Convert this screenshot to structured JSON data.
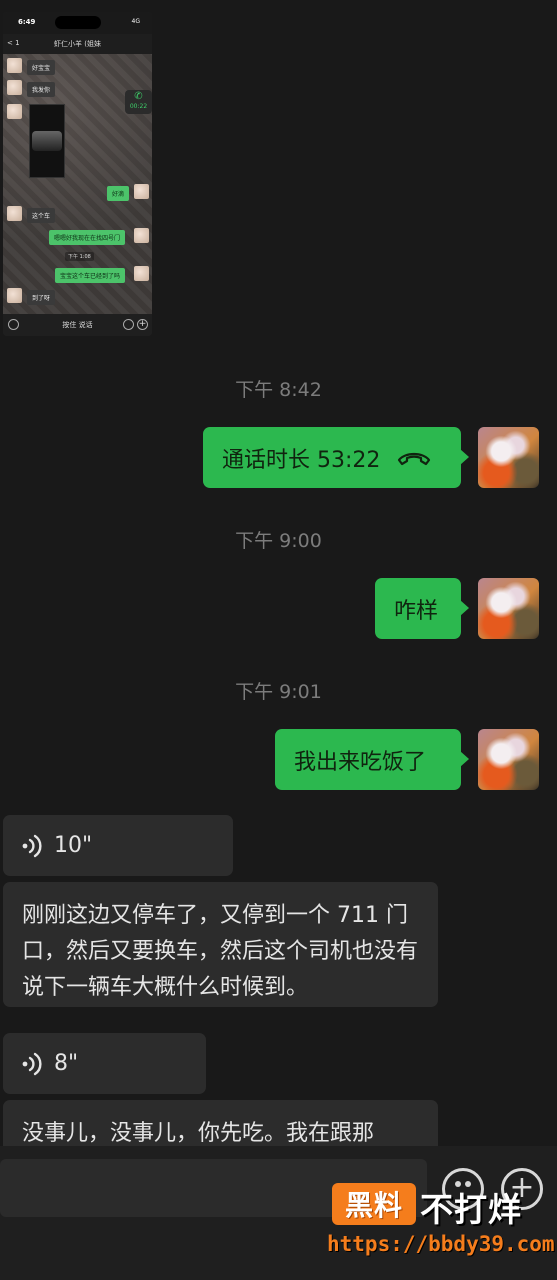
{
  "thumbnail": {
    "status_time": "6:49",
    "status_signal": "4G",
    "nav_back": "< 1",
    "nav_title": "虾仁小羊 (姐妹",
    "messages": [
      {
        "dir": "in",
        "text": "好宝宝"
      },
      {
        "dir": "in",
        "text": "我发你"
      },
      {
        "dir": "out",
        "text": "好滴"
      },
      {
        "dir": "in",
        "text": "这个车"
      },
      {
        "dir": "out",
        "text": "嗯嗯好我现在在找四号门"
      },
      {
        "dir": "out",
        "text": "宝宝这个车已经到了吗"
      },
      {
        "dir": "in",
        "text": "到了呀"
      }
    ],
    "call_duration": "00:22",
    "timestamp": "下午 1:08",
    "input_placeholder": "按住 说话"
  },
  "chat": {
    "ts1": "下午 8:42",
    "call_bubble": "通话时长 53:22",
    "ts2": "下午 9:00",
    "msg_zenyang": "咋样",
    "ts3": "下午 9:01",
    "msg_chifan": "我出来吃饭了",
    "voice1_duration": "10\"",
    "text1": "刚刚这边又停车了，又停到一个 711 门口，然后又要换车，然后这个司机也没有说下一辆车大概什么时候到。",
    "voice2_duration": "8\"",
    "text2": "没事儿，没事儿，你先吃。我在跟那"
  },
  "watermark": {
    "brand_box": "黑料",
    "brand_side": "不打烊",
    "url": "https://bbdy39.com"
  },
  "colors": {
    "background": "#191919",
    "outgoing_bubble": "#2cb84f",
    "incoming_bubble": "#2c2c2c",
    "watermark_orange": "#f57d1c"
  }
}
